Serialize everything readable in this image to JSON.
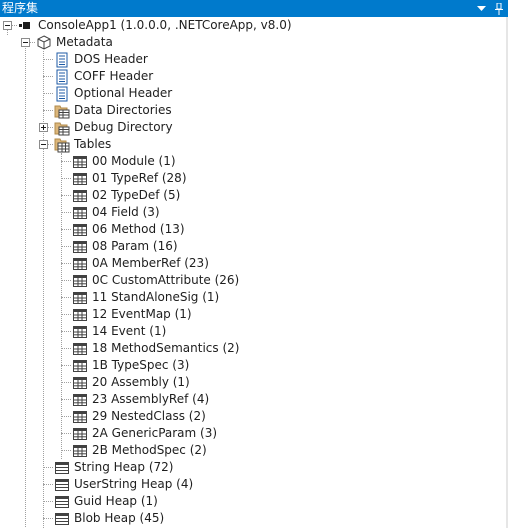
{
  "panel": {
    "title": "程序集",
    "dropdown_icon": "chevron-down-icon",
    "pin_icon": "pin-icon"
  },
  "tree": {
    "root": {
      "label": "ConsoleApp1 (1.0.0.0, .NETCoreApp, v8.0)",
      "icon": "assembly-icon",
      "expanded": true
    },
    "metadata": {
      "label": "Metadata",
      "icon": "metadata-cube-icon",
      "expanded": true
    },
    "headers": [
      {
        "label": "DOS Header",
        "icon": "document-icon"
      },
      {
        "label": "COFF Header",
        "icon": "document-icon"
      },
      {
        "label": "Optional Header",
        "icon": "document-icon"
      }
    ],
    "data_directories": {
      "label": "Data Directories",
      "icon": "folder-table-icon"
    },
    "debug_directory": {
      "label": "Debug Directory",
      "icon": "folder-table-icon",
      "expanded": false
    },
    "tables": {
      "label": "Tables",
      "icon": "table-grid-icon",
      "expanded": true,
      "items": [
        {
          "label": "00 Module (1)"
        },
        {
          "label": "01 TypeRef (28)"
        },
        {
          "label": "02 TypeDef (5)"
        },
        {
          "label": "04 Field (3)"
        },
        {
          "label": "06 Method (13)"
        },
        {
          "label": "08 Param (16)"
        },
        {
          "label": "0A MemberRef (23)"
        },
        {
          "label": "0C CustomAttribute (26)"
        },
        {
          "label": "11 StandAloneSig (1)"
        },
        {
          "label": "12 EventMap (1)"
        },
        {
          "label": "14 Event (1)"
        },
        {
          "label": "18 MethodSemantics (2)"
        },
        {
          "label": "1B TypeSpec (3)"
        },
        {
          "label": "20 Assembly (1)"
        },
        {
          "label": "23 AssemblyRef (4)"
        },
        {
          "label": "29 NestedClass (2)"
        },
        {
          "label": "2A GenericParam (3)"
        },
        {
          "label": "2B MethodSpec (2)"
        }
      ]
    },
    "heaps": [
      {
        "label": "String Heap (72)",
        "icon": "heap-icon"
      },
      {
        "label": "UserString Heap (4)",
        "icon": "heap-icon"
      },
      {
        "label": "Guid Heap (1)",
        "icon": "heap-icon"
      },
      {
        "label": "Blob Heap (45)",
        "icon": "heap-icon"
      }
    ]
  }
}
